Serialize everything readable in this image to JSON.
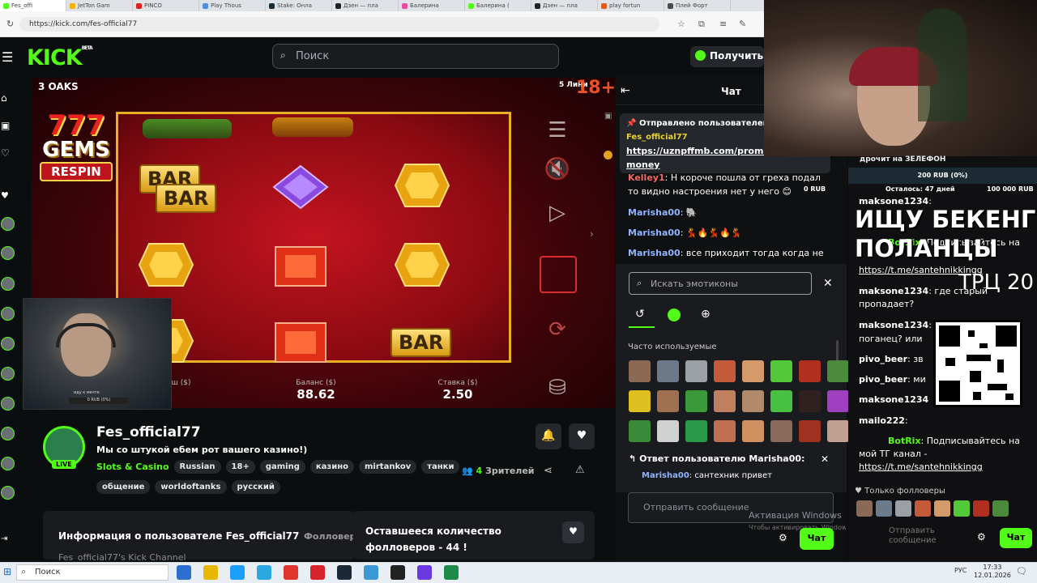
{
  "browser": {
    "tabs": [
      {
        "label": "Fes_offi",
        "color": "#53fc18"
      },
      {
        "label": "JetTon Gam",
        "color": "#f5b400"
      },
      {
        "label": "PINCO",
        "color": "#e02020"
      },
      {
        "label": "Play Thous",
        "color": "#4a90e2"
      },
      {
        "label": "Stake: Онла",
        "color": "#1a2c38"
      },
      {
        "label": "Дзен — пла",
        "color": "#222222"
      },
      {
        "label": "Балерина",
        "color": "#e74aa0"
      },
      {
        "label": "Балерина (",
        "color": "#53fc18"
      },
      {
        "label": "Дзен — пла",
        "color": "#222222"
      },
      {
        "label": "play fortun",
        "color": "#e05a20"
      },
      {
        "label": "Плей Форт",
        "color": "#4a4a4a"
      }
    ],
    "url": "https://kick.com/fes-official77"
  },
  "header": {
    "logo": "KICK",
    "logo_sup": "BETA",
    "search_placeholder": "Поиск",
    "get_button": "Получить K"
  },
  "game": {
    "name": "3 OAKS",
    "lines": "5 Лини",
    "age": "18+",
    "brand_line1": "777",
    "brand_line2": "GEMS",
    "brand_line3": "RESPIN",
    "bar_label": "BAR",
    "win_label": "ыш ($)",
    "balance_label": "Баланс ($)",
    "balance_value": "88.62",
    "bet_label": "Ставка ($)",
    "bet_value": "2.50"
  },
  "webcam1": {
    "caption1": "иду к мечте",
    "caption2": "0 RUB (0%)"
  },
  "channel": {
    "name": "Fes_official77",
    "title": "Мы со штукой ебем рот вашего казино!)",
    "live": "LIVE",
    "category": "Slots & Casino",
    "tags_row1": [
      "Russian",
      "18+",
      "gaming",
      "казино",
      "mirtankov",
      "танки"
    ],
    "tags_row2": [
      "общение",
      "worldoftanks",
      "русский"
    ],
    "viewers_count": "4",
    "viewers_label": "Зрителей"
  },
  "info": {
    "title": "Информация о пользователе Fes_official77",
    "followers_label": "Фолловеры",
    "subtitle": "Fes_official77's Kick Channel",
    "followers_left": "Оставшееся количество фолловеров - 44 !"
  },
  "chat": {
    "title": "Чат",
    "pinned_by": "Отправлено пользователем",
    "pinned_user": "Fes_official77",
    "pinned_link": "https://uznpffmb.com/promo",
    "pinned_link2": "money",
    "messages": [
      {
        "nick": "Kelley1",
        "color": "#f06a6a",
        "text": ": Н короче пошла от греха подал"
      },
      {
        "nick": "",
        "color": "#ffffff",
        "text": "то видно настроения нет у него 😊"
      },
      {
        "nick": "Marisha00",
        "color": "#8fb4ff",
        "text": ": 🐘"
      },
      {
        "nick": "Marisha00",
        "color": "#8fb4ff",
        "text": ": 💃🔥💃🔥💃"
      },
      {
        "nick": "Marisha00",
        "color": "#8fb4ff",
        "text": ": все приходит тогда когда не"
      }
    ],
    "emote_search": "Искать эмотиконы",
    "frequent_label": "Часто используемые",
    "reply_header": "Ответ пользователю Marisha00:",
    "reply_user": "Marisha00",
    "reply_text": ": сантехник привет",
    "send_placeholder": "Отправить сообщение",
    "chat_button": "Чат",
    "win_activation": "Активация Windows",
    "win_activation_sub": "Чтобы активировать Windows, перейдите в раздел \"Параметры\".",
    "emote_colors": [
      [
        "#8a6a55",
        "#6c7a8a",
        "#9aa0a6",
        "#c35a3a",
        "#d49a6a",
        "#53c93a",
        "#b03020",
        "#4a8a3a"
      ],
      [
        "#e0c020",
        "#a07050",
        "#3a9a3a",
        "#c08060",
        "#b08a6a",
        "#48c040",
        "#302020",
        "#a040c0"
      ],
      [
        "#3a8a3a",
        "#d0d0d0",
        "#2a9a4a",
        "#c07050",
        "#d09060",
        "#8a6a5a",
        "#a03020",
        "#c0a090"
      ]
    ]
  },
  "overlay": {
    "top_text": "дрочит на ЗЕЛЕФОН",
    "donate": "200 RUB (0%)",
    "left_label": "0 RUB",
    "days": "Осталось: 47 дней",
    "goal": "100 000 RUB",
    "big1": "ИЩУ БЕКЕНГ",
    "big2": "ПОЛАНЦЫ",
    "trc": "ТРЦ 20",
    "messages": [
      {
        "nick": "maksone1234",
        "color": "#ffffff",
        "text": ":"
      },
      {
        "nick": "BotRix",
        "color": "#53fc18",
        "text": ": Подписывайтесь на"
      },
      {
        "nick": "",
        "color": "#ffffff",
        "text": "https://t.me/santehnikkingg"
      },
      {
        "nick": "maksone1234",
        "color": "#ffffff",
        "text": ": где старый"
      },
      {
        "nick": "",
        "color": "#ffffff",
        "text": "пропадает?"
      },
      {
        "nick": "maksone1234",
        "color": "#ffffff",
        "text": ":"
      },
      {
        "nick": "",
        "color": "#ffffff",
        "text": "поганец? или"
      },
      {
        "nick": "pivo_beer",
        "color": "#ffffff",
        "text": ": зв"
      },
      {
        "nick": "pivo_beer",
        "color": "#ffffff",
        "text": ": ми"
      },
      {
        "nick": "maksone1234",
        "color": "#ffffff",
        "text": ""
      },
      {
        "nick": "mailo222",
        "color": "#ffffff",
        "text": ":"
      },
      {
        "nick": "BotRix",
        "color": "#53fc18",
        "text": ": Подписывайтесь на"
      },
      {
        "nick": "",
        "color": "#ffffff",
        "text": "мой ТГ канал -"
      },
      {
        "nick": "",
        "color": "#ffffff",
        "text": "https://t.me/santehnikkingg"
      }
    ],
    "followers_only": "Только фолловеры",
    "send_placeholder": "Отправить сообщение",
    "chat_button": "Чат"
  },
  "taskbar": {
    "search": "Поиск",
    "lang": "РУС",
    "time": "17:33",
    "date": "12.01.2026",
    "icons": [
      "#2d6fd1",
      "#e6b800",
      "#1a9fff",
      "#2aa8e0",
      "#e0342c",
      "#d6222a",
      "#1b2838",
      "#3b98d4",
      "#222222",
      "#6a3ae0",
      "#1e8a4a"
    ]
  }
}
